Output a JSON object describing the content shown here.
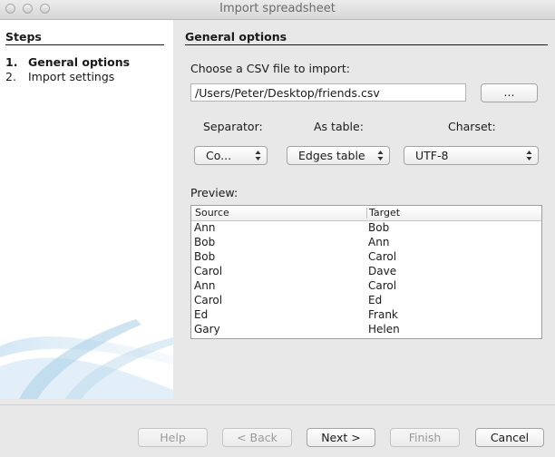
{
  "window": {
    "title": "Import spreadsheet"
  },
  "sidebar": {
    "heading": "Steps",
    "steps": [
      {
        "num": "1.",
        "label": "General options",
        "active": true
      },
      {
        "num": "2.",
        "label": "Import settings",
        "active": false
      }
    ]
  },
  "main": {
    "heading": "General options",
    "choose_label": "Choose a CSV file to import:",
    "file_path": "/Users/Peter/Desktop/friends.csv",
    "browse_label": "...",
    "separator": {
      "label": "Separator:",
      "value": "Co..."
    },
    "as_table": {
      "label": "As table:",
      "value": "Edges table"
    },
    "charset": {
      "label": "Charset:",
      "value": "UTF-8"
    },
    "preview": {
      "label": "Preview:",
      "columns": [
        "Source",
        "Target"
      ],
      "rows": [
        [
          "Ann",
          "Bob"
        ],
        [
          "Bob",
          "Ann"
        ],
        [
          "Bob",
          "Carol"
        ],
        [
          "Carol",
          "Dave"
        ],
        [
          "Ann",
          "Carol"
        ],
        [
          "Carol",
          "Ed"
        ],
        [
          "Ed",
          "Frank"
        ],
        [
          "Gary",
          "Helen"
        ]
      ]
    }
  },
  "footer": {
    "help": "Help",
    "back": "< Back",
    "next": "Next >",
    "finish": "Finish",
    "cancel": "Cancel"
  }
}
